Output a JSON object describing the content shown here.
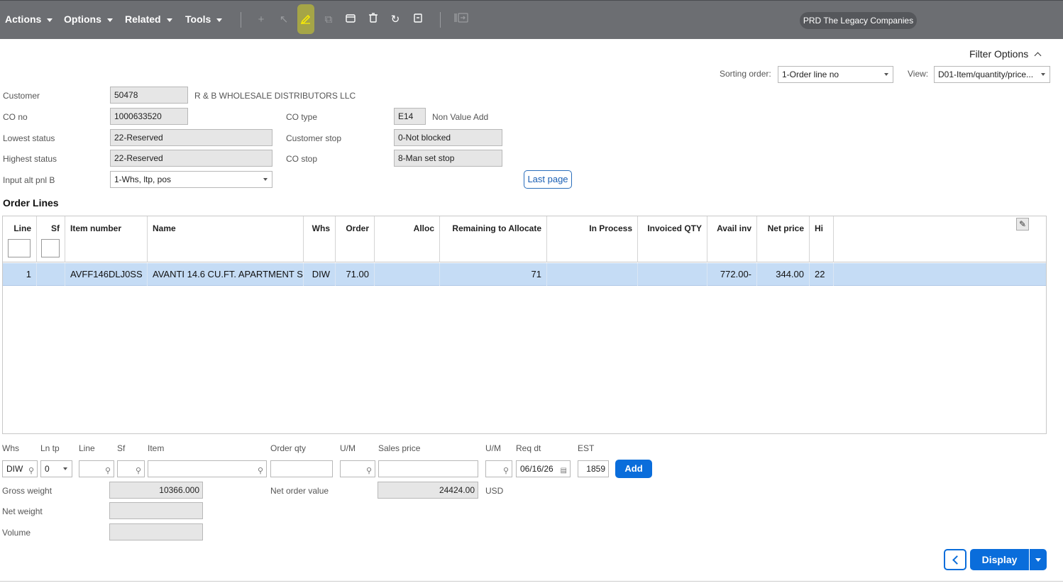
{
  "toolbar": {
    "menus": [
      "Actions",
      "Options",
      "Related",
      "Tools"
    ],
    "company": "PRD The Legacy Companies"
  },
  "filter": {
    "label": "Filter Options",
    "sorting_label": "Sorting order:",
    "sorting_value": "1-Order line no",
    "view_label": "View:",
    "view_value": "D01-Item/quantity/price..."
  },
  "header": {
    "customer_label": "Customer",
    "customer_value": "50478",
    "customer_name": "R & B WHOLESALE DISTRIBUTORS LLC",
    "co_no_label": "CO no",
    "co_no_value": "1000633520",
    "co_type_label": "CO type",
    "co_type_value": "E14",
    "co_type_desc": "Non Value Add",
    "lowest_status_label": "Lowest status",
    "lowest_status_value": "22-Reserved",
    "customer_stop_label": "Customer stop",
    "customer_stop_value": "0-Not blocked",
    "highest_status_label": "Highest status",
    "highest_status_value": "22-Reserved",
    "co_stop_label": "CO stop",
    "co_stop_value": "8-Man set stop",
    "input_alt_label": "Input alt pnl B",
    "input_alt_value": "1-Whs, ltp, pos",
    "last_page": "Last page"
  },
  "order_lines": {
    "title": "Order Lines",
    "columns": [
      "Line",
      "Sf",
      "Item number",
      "Name",
      "Whs",
      "Order",
      "Alloc",
      "Remaining to Allocate",
      "In Process",
      "Invoiced QTY",
      "Avail inv",
      "Net price",
      "Hi"
    ],
    "rows": [
      [
        "1",
        "",
        "AVFF146DLJ0SS",
        "AVANTI 14.6 CU.FT. APARTMENT S",
        "DIW",
        "71.00",
        "",
        "71",
        "",
        "",
        "772.00-",
        "344.00",
        "22"
      ]
    ]
  },
  "entry": {
    "labels": [
      "Whs",
      "Ln tp",
      "Line",
      "Sf",
      "Item",
      "Order qty",
      "U/M",
      "Sales price",
      "U/M",
      "Req dt",
      "EST"
    ],
    "whs_value": "DIW",
    "ln_tp_value": "0",
    "req_dt_value": "06/16/26",
    "est_value": "1859",
    "add_label": "Add"
  },
  "totals": {
    "gross_weight_label": "Gross weight",
    "gross_weight_value": "10366.000",
    "net_weight_label": "Net weight",
    "volume_label": "Volume",
    "net_order_value_label": "Net order value",
    "net_order_value": "24424.00",
    "currency": "USD"
  },
  "footer": {
    "display_label": "Display"
  }
}
